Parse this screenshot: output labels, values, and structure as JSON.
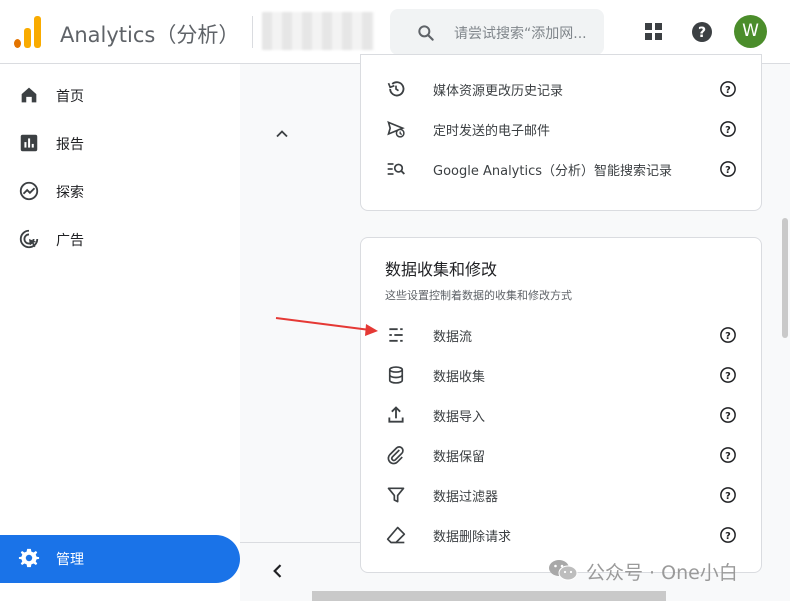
{
  "header": {
    "app_title": "Analytics（分析）",
    "search_placeholder": "请尝试搜索“添加网...",
    "avatar_letter": "W"
  },
  "sidebar": {
    "items": [
      {
        "label": "首页",
        "icon": "home-icon"
      },
      {
        "label": "报告",
        "icon": "bar-chart-icon"
      },
      {
        "label": "探索",
        "icon": "explore-icon"
      },
      {
        "label": "广告",
        "icon": "ads-icon"
      }
    ],
    "admin_label": "管理"
  },
  "card_top": {
    "rows": [
      {
        "label": "媒体资源更改历史记录",
        "icon": "history-icon"
      },
      {
        "label": "定时发送的电子邮件",
        "icon": "scheduled-email-icon"
      },
      {
        "label": "Google Analytics（分析）智能搜索记录",
        "icon": "search-history-icon"
      }
    ]
  },
  "data_section": {
    "title": "数据收集和修改",
    "subtitle": "这些设置控制着数据的收集和修改方式",
    "rows": [
      {
        "label": "数据流",
        "icon": "data-streams-icon"
      },
      {
        "label": "数据收集",
        "icon": "database-icon"
      },
      {
        "label": "数据导入",
        "icon": "upload-icon"
      },
      {
        "label": "数据保留",
        "icon": "paperclip-icon"
      },
      {
        "label": "数据过滤器",
        "icon": "filter-icon"
      },
      {
        "label": "数据删除请求",
        "icon": "eraser-icon"
      }
    ]
  },
  "watermark": {
    "text": "公众号 · One小白"
  },
  "colors": {
    "accent": "#1a73e8",
    "avatar": "#4b8d2b",
    "logo_orange": "#f9ab00",
    "logo_dark": "#e37400",
    "arrow": "#e53935"
  }
}
